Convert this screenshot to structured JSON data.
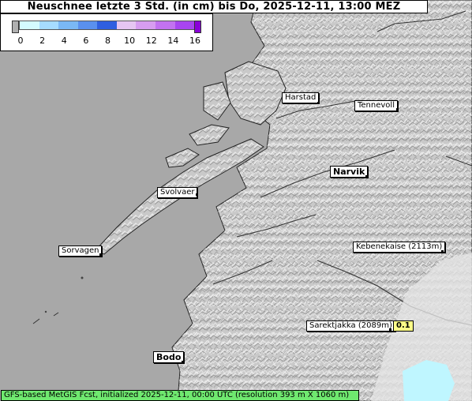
{
  "title": "Neuschnee letzte 3 Std. (in cm) bis Do, 2025-12-11, 13:00 MEZ",
  "legend": {
    "ticks": [
      "0",
      "2",
      "4",
      "6",
      "8",
      "10",
      "12",
      "14",
      "16"
    ],
    "colors": [
      "#d4fbff",
      "#a6dcff",
      "#7ab8f5",
      "#5a90ee",
      "#2f5fe0",
      "#e6c6f2",
      "#d79df0",
      "#c272f0",
      "#a845f0"
    ],
    "below_color": "#b0b0b0",
    "above_color": "#8a00d8"
  },
  "places": [
    {
      "name": "Harstad"
    },
    {
      "name": "Tennevoll"
    },
    {
      "name": "Narvik"
    },
    {
      "name": "Svolvaer"
    },
    {
      "name": "Sorvagen"
    },
    {
      "name": "Kebenekaise (2113m)"
    },
    {
      "name": "Sarektjakka (2089m)",
      "value": "0.1"
    },
    {
      "name": "Bodo"
    }
  ],
  "footer": "GFS-based MetGIS Fcst, initialized 2025-12-11, 00:00 UTC  (resolution 393 m X 1060 m)"
}
